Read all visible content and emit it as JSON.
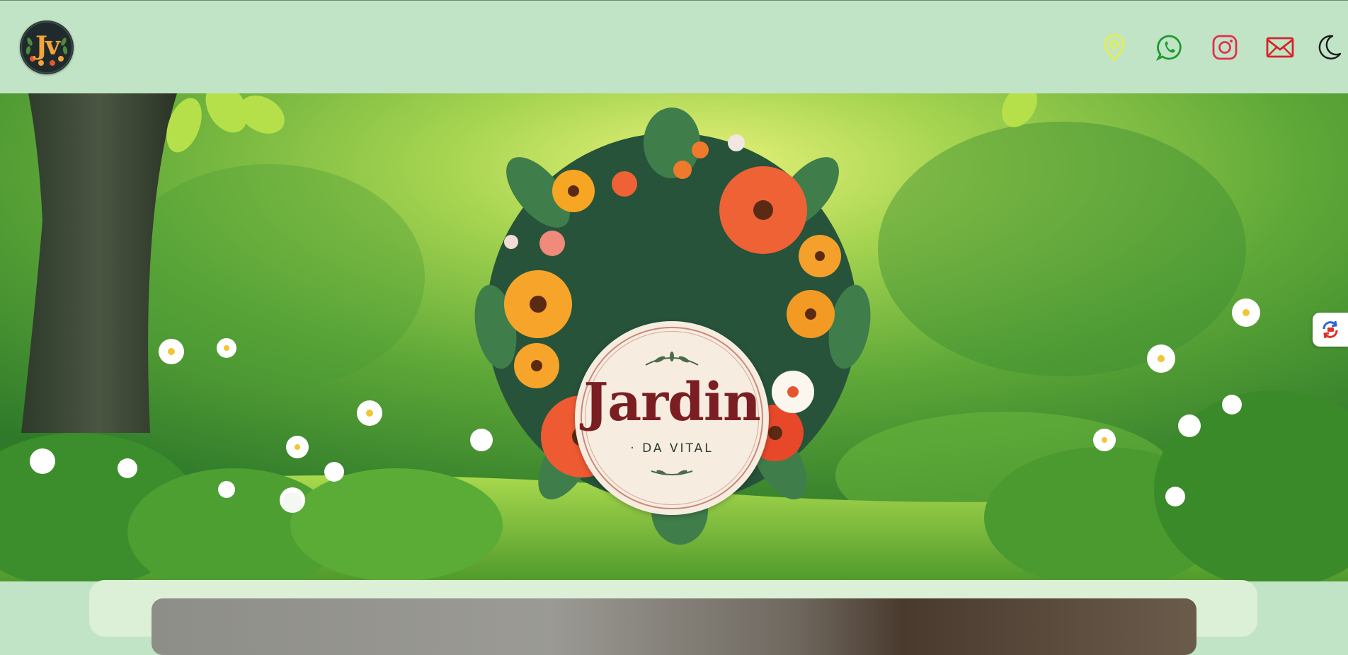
{
  "header": {
    "logo": {
      "letters": "Jv",
      "alt": "Jardin da Vital logo"
    },
    "icons": [
      {
        "name": "location-pin-icon",
        "color": "#f2f24a"
      },
      {
        "name": "whatsapp-icon",
        "color": "#2a9d2a"
      },
      {
        "name": "instagram-icon",
        "color": "#e23a5a"
      },
      {
        "name": "mail-icon",
        "color": "#d4262a"
      },
      {
        "name": "moon-icon",
        "color": "#1a1a1a"
      }
    ]
  },
  "hero": {
    "brand_title": "Jardin",
    "brand_subtitle": "· DA VITAL"
  },
  "side_tab": {
    "icon": "translate-refresh-icon"
  },
  "colors": {
    "header_bg": "#c2e4c6",
    "brand_text": "#7a1e22",
    "badge_bg": "#f6ece0",
    "card_bg": "#dcefd7"
  }
}
